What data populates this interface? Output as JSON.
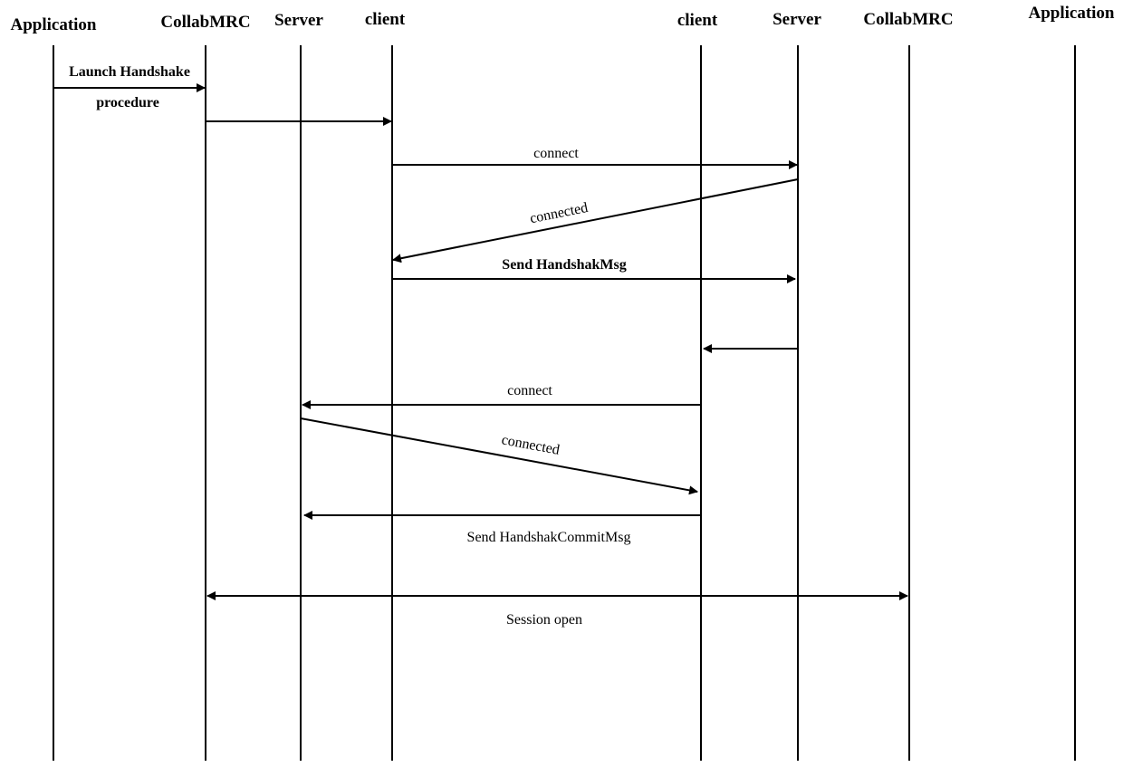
{
  "diagram": {
    "type": "sequence",
    "actors": [
      {
        "id": "app_left",
        "label": "Application"
      },
      {
        "id": "mrc_left",
        "label": "CollabMRC"
      },
      {
        "id": "server_left",
        "label": "Server"
      },
      {
        "id": "client_left",
        "label": "client"
      },
      {
        "id": "client_right",
        "label": "client"
      },
      {
        "id": "server_right",
        "label": "Server"
      },
      {
        "id": "mrc_right",
        "label": "CollabMRC"
      },
      {
        "id": "app_right",
        "label": "Application"
      }
    ],
    "messages": [
      {
        "from": "app_left",
        "to": "mrc_left",
        "label_lines": [
          "Launch Handshake",
          "procedure"
        ]
      },
      {
        "from": "mrc_left",
        "to": "client_left",
        "label_lines": []
      },
      {
        "from": "client_left",
        "to": "server_right",
        "label_lines": [
          "connect"
        ]
      },
      {
        "from": "server_right",
        "to": "client_left",
        "label_lines": [
          "connected"
        ]
      },
      {
        "from": "client_left",
        "to": "server_right",
        "label_lines": [
          "Send HandshakMsg"
        ]
      },
      {
        "from": "server_right",
        "to": "client_right",
        "label_lines": []
      },
      {
        "from": "client_right",
        "to": "server_left",
        "label_lines": [
          "connect"
        ]
      },
      {
        "from": "server_left",
        "to": "client_right",
        "label_lines": [
          "connected"
        ]
      },
      {
        "from": "client_right",
        "to": "server_left",
        "label_lines": [
          "Send HandshakCommitMsg"
        ]
      },
      {
        "from": "mrc_left",
        "to": "mrc_right",
        "bidirectional": true,
        "label_lines": [
          "Session open"
        ]
      }
    ]
  }
}
